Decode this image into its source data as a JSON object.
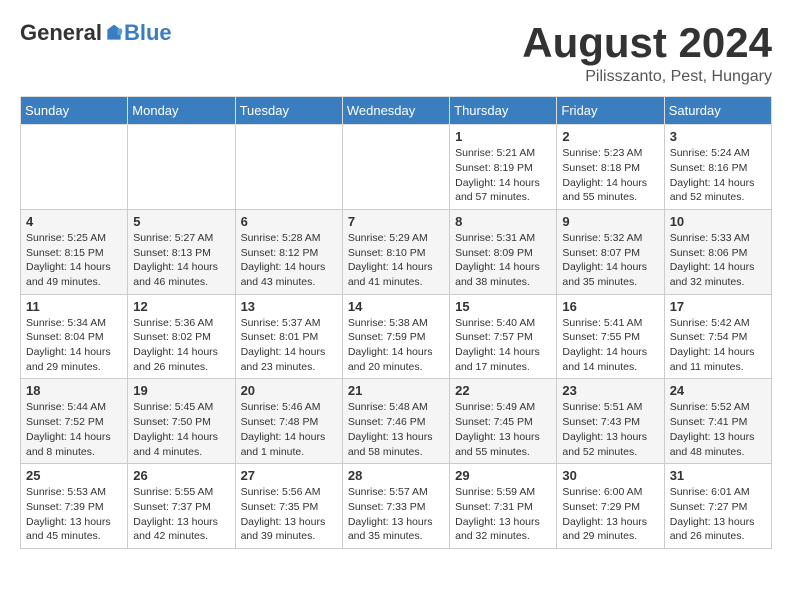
{
  "header": {
    "logo_general": "General",
    "logo_blue": "Blue",
    "month_title": "August 2024",
    "location": "Pilisszanto, Pest, Hungary"
  },
  "weekdays": [
    "Sunday",
    "Monday",
    "Tuesday",
    "Wednesday",
    "Thursday",
    "Friday",
    "Saturday"
  ],
  "weeks": [
    [
      {
        "day": "",
        "info": ""
      },
      {
        "day": "",
        "info": ""
      },
      {
        "day": "",
        "info": ""
      },
      {
        "day": "",
        "info": ""
      },
      {
        "day": "1",
        "info": "Sunrise: 5:21 AM\nSunset: 8:19 PM\nDaylight: 14 hours\nand 57 minutes."
      },
      {
        "day": "2",
        "info": "Sunrise: 5:23 AM\nSunset: 8:18 PM\nDaylight: 14 hours\nand 55 minutes."
      },
      {
        "day": "3",
        "info": "Sunrise: 5:24 AM\nSunset: 8:16 PM\nDaylight: 14 hours\nand 52 minutes."
      }
    ],
    [
      {
        "day": "4",
        "info": "Sunrise: 5:25 AM\nSunset: 8:15 PM\nDaylight: 14 hours\nand 49 minutes."
      },
      {
        "day": "5",
        "info": "Sunrise: 5:27 AM\nSunset: 8:13 PM\nDaylight: 14 hours\nand 46 minutes."
      },
      {
        "day": "6",
        "info": "Sunrise: 5:28 AM\nSunset: 8:12 PM\nDaylight: 14 hours\nand 43 minutes."
      },
      {
        "day": "7",
        "info": "Sunrise: 5:29 AM\nSunset: 8:10 PM\nDaylight: 14 hours\nand 41 minutes."
      },
      {
        "day": "8",
        "info": "Sunrise: 5:31 AM\nSunset: 8:09 PM\nDaylight: 14 hours\nand 38 minutes."
      },
      {
        "day": "9",
        "info": "Sunrise: 5:32 AM\nSunset: 8:07 PM\nDaylight: 14 hours\nand 35 minutes."
      },
      {
        "day": "10",
        "info": "Sunrise: 5:33 AM\nSunset: 8:06 PM\nDaylight: 14 hours\nand 32 minutes."
      }
    ],
    [
      {
        "day": "11",
        "info": "Sunrise: 5:34 AM\nSunset: 8:04 PM\nDaylight: 14 hours\nand 29 minutes."
      },
      {
        "day": "12",
        "info": "Sunrise: 5:36 AM\nSunset: 8:02 PM\nDaylight: 14 hours\nand 26 minutes."
      },
      {
        "day": "13",
        "info": "Sunrise: 5:37 AM\nSunset: 8:01 PM\nDaylight: 14 hours\nand 23 minutes."
      },
      {
        "day": "14",
        "info": "Sunrise: 5:38 AM\nSunset: 7:59 PM\nDaylight: 14 hours\nand 20 minutes."
      },
      {
        "day": "15",
        "info": "Sunrise: 5:40 AM\nSunset: 7:57 PM\nDaylight: 14 hours\nand 17 minutes."
      },
      {
        "day": "16",
        "info": "Sunrise: 5:41 AM\nSunset: 7:55 PM\nDaylight: 14 hours\nand 14 minutes."
      },
      {
        "day": "17",
        "info": "Sunrise: 5:42 AM\nSunset: 7:54 PM\nDaylight: 14 hours\nand 11 minutes."
      }
    ],
    [
      {
        "day": "18",
        "info": "Sunrise: 5:44 AM\nSunset: 7:52 PM\nDaylight: 14 hours\nand 8 minutes."
      },
      {
        "day": "19",
        "info": "Sunrise: 5:45 AM\nSunset: 7:50 PM\nDaylight: 14 hours\nand 4 minutes."
      },
      {
        "day": "20",
        "info": "Sunrise: 5:46 AM\nSunset: 7:48 PM\nDaylight: 14 hours\nand 1 minute."
      },
      {
        "day": "21",
        "info": "Sunrise: 5:48 AM\nSunset: 7:46 PM\nDaylight: 13 hours\nand 58 minutes."
      },
      {
        "day": "22",
        "info": "Sunrise: 5:49 AM\nSunset: 7:45 PM\nDaylight: 13 hours\nand 55 minutes."
      },
      {
        "day": "23",
        "info": "Sunrise: 5:51 AM\nSunset: 7:43 PM\nDaylight: 13 hours\nand 52 minutes."
      },
      {
        "day": "24",
        "info": "Sunrise: 5:52 AM\nSunset: 7:41 PM\nDaylight: 13 hours\nand 48 minutes."
      }
    ],
    [
      {
        "day": "25",
        "info": "Sunrise: 5:53 AM\nSunset: 7:39 PM\nDaylight: 13 hours\nand 45 minutes."
      },
      {
        "day": "26",
        "info": "Sunrise: 5:55 AM\nSunset: 7:37 PM\nDaylight: 13 hours\nand 42 minutes."
      },
      {
        "day": "27",
        "info": "Sunrise: 5:56 AM\nSunset: 7:35 PM\nDaylight: 13 hours\nand 39 minutes."
      },
      {
        "day": "28",
        "info": "Sunrise: 5:57 AM\nSunset: 7:33 PM\nDaylight: 13 hours\nand 35 minutes."
      },
      {
        "day": "29",
        "info": "Sunrise: 5:59 AM\nSunset: 7:31 PM\nDaylight: 13 hours\nand 32 minutes."
      },
      {
        "day": "30",
        "info": "Sunrise: 6:00 AM\nSunset: 7:29 PM\nDaylight: 13 hours\nand 29 minutes."
      },
      {
        "day": "31",
        "info": "Sunrise: 6:01 AM\nSunset: 7:27 PM\nDaylight: 13 hours\nand 26 minutes."
      }
    ]
  ]
}
